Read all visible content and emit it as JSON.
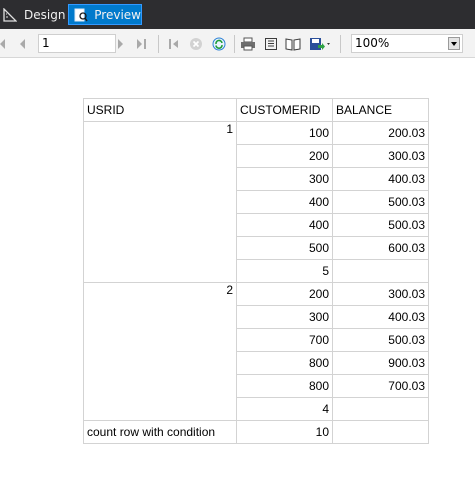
{
  "tabs": {
    "design": "Design",
    "preview": "Preview"
  },
  "toolbar": {
    "page_value": "1",
    "zoom_value": "100%"
  },
  "report": {
    "headers": [
      "USRID",
      "CUSTOMERID",
      "BALANCE"
    ],
    "groups": [
      {
        "usrid": "1",
        "rows": [
          {
            "customerid": "100",
            "balance": "200.03"
          },
          {
            "customerid": "200",
            "balance": "300.03"
          },
          {
            "customerid": "300",
            "balance": "400.03"
          },
          {
            "customerid": "400",
            "balance": "500.03"
          },
          {
            "customerid": "400",
            "balance": "500.03"
          },
          {
            "customerid": "500",
            "balance": "600.03"
          }
        ],
        "count": "5"
      },
      {
        "usrid": "2",
        "rows": [
          {
            "customerid": "200",
            "balance": "300.03"
          },
          {
            "customerid": "300",
            "balance": "400.03"
          },
          {
            "customerid": "700",
            "balance": "500.03"
          },
          {
            "customerid": "800",
            "balance": "900.03"
          },
          {
            "customerid": "800",
            "balance": "700.03"
          }
        ],
        "count": "4"
      }
    ],
    "footer_label": "count row with condition",
    "footer_value": "10"
  },
  "colors": {
    "tabbar_bg": "#2d2d30",
    "preview_tab_bg": "#007acc",
    "toolbar_bg": "#f3f3f3",
    "grid_border": "#d3d3d3"
  },
  "icons": [
    "ruler-icon",
    "preview-icon",
    "first-page-icon",
    "previous-page-icon",
    "next-page-icon",
    "last-page-icon",
    "back-icon",
    "stop-icon",
    "refresh-icon",
    "print-icon",
    "print-layout-icon",
    "page-setup-icon",
    "export-icon",
    "chevron-down-icon"
  ]
}
